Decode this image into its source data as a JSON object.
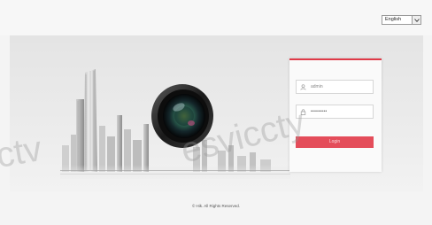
{
  "header": {
    "language": "English"
  },
  "login": {
    "username_value": "admin",
    "password_value": "•••••••••",
    "login_label": "Login"
  },
  "watermarks": {
    "left": "ctv",
    "center": "esviccty"
  },
  "footer": {
    "copyright": "© Hik. All Rights Reserved."
  },
  "colors": {
    "accent": "#e03a48",
    "button": "#e44d5a"
  }
}
